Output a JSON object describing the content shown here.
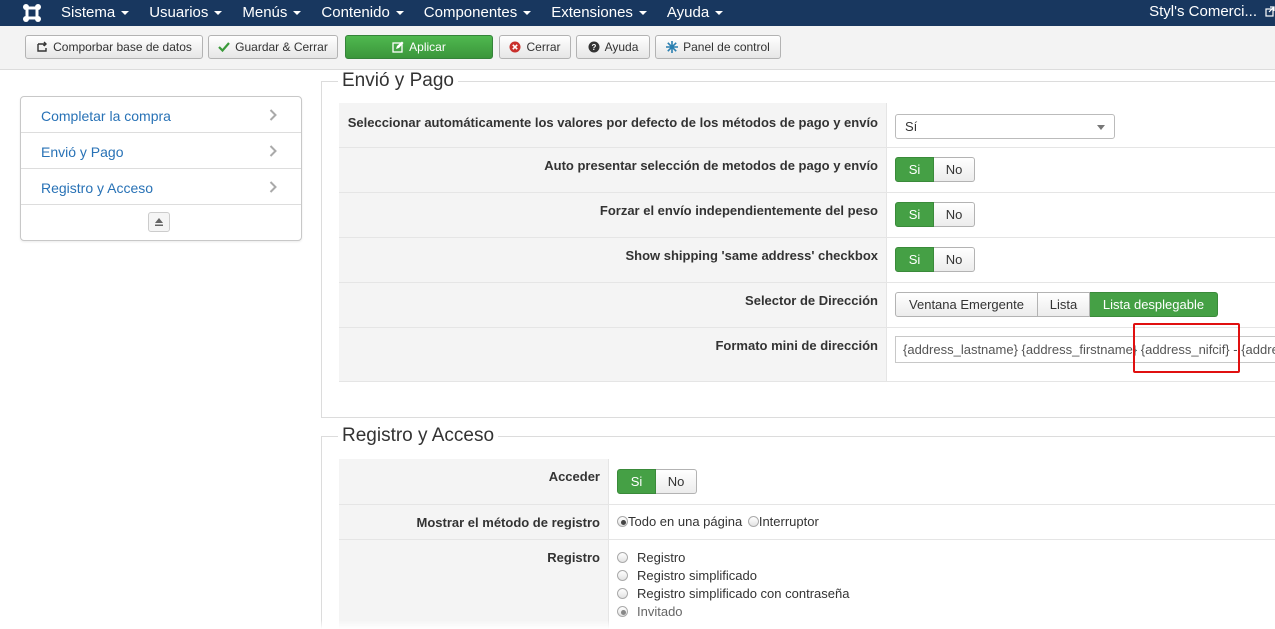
{
  "navbar": {
    "menu": [
      {
        "label": "Sistema"
      },
      {
        "label": "Usuarios"
      },
      {
        "label": "Menús"
      },
      {
        "label": "Contenido"
      },
      {
        "label": "Componentes"
      },
      {
        "label": "Extensiones"
      },
      {
        "label": "Ayuda"
      }
    ],
    "site_name": "Styl's Comerci..."
  },
  "toolbar": {
    "check_db": "Comporbar base de datos",
    "save_close": "Guardar & Cerrar",
    "apply": "Aplicar",
    "close": "Cerrar",
    "help": "Ayuda",
    "control_panel": "Panel de control"
  },
  "sidebar": {
    "items": [
      {
        "label": "Completar la compra"
      },
      {
        "label": "Envió y Pago"
      },
      {
        "label": "Registro y Acceso"
      }
    ]
  },
  "shipping": {
    "legend": "Envió y Pago",
    "auto_select_label": "Seleccionar automáticamente los valores por defecto de los métodos de pago y envío",
    "auto_select_value": "Sí",
    "auto_present_label": "Auto presentar selección de metodos de pago y envío",
    "force_shipping_label": "Forzar el envío independientemente del peso",
    "same_address_label": "Show shipping 'same address' checkbox",
    "address_selector_label": "Selector de Dirección",
    "address_selector_options": [
      "Ventana Emergente",
      "Lista",
      "Lista desplegable"
    ],
    "address_selector_selected": "Lista desplegable",
    "mini_address_label": "Formato mini de dirección",
    "mini_address_value": "{address_lastname} {address_firstname} {address_nifcif} - {address_zip}"
  },
  "yes_no": {
    "yes": "Si",
    "no": "No"
  },
  "registration": {
    "legend": "Registro y Acceso",
    "login_label": "Acceder",
    "show_method_label": "Mostrar el método de registro",
    "show_method_options": [
      "Todo en una página",
      "Interruptor"
    ],
    "show_method_selected": "Todo en una página",
    "registration_label": "Registro",
    "registration_options": [
      "Registro",
      "Registro simplificado",
      "Registro simplificado con contraseña",
      "Invitado"
    ],
    "registration_selected": "Invitado"
  },
  "colors": {
    "navbar": "#18375f",
    "accent_green": "#45a045",
    "link_blue": "#2872b6",
    "highlight_red": "#e01010"
  }
}
